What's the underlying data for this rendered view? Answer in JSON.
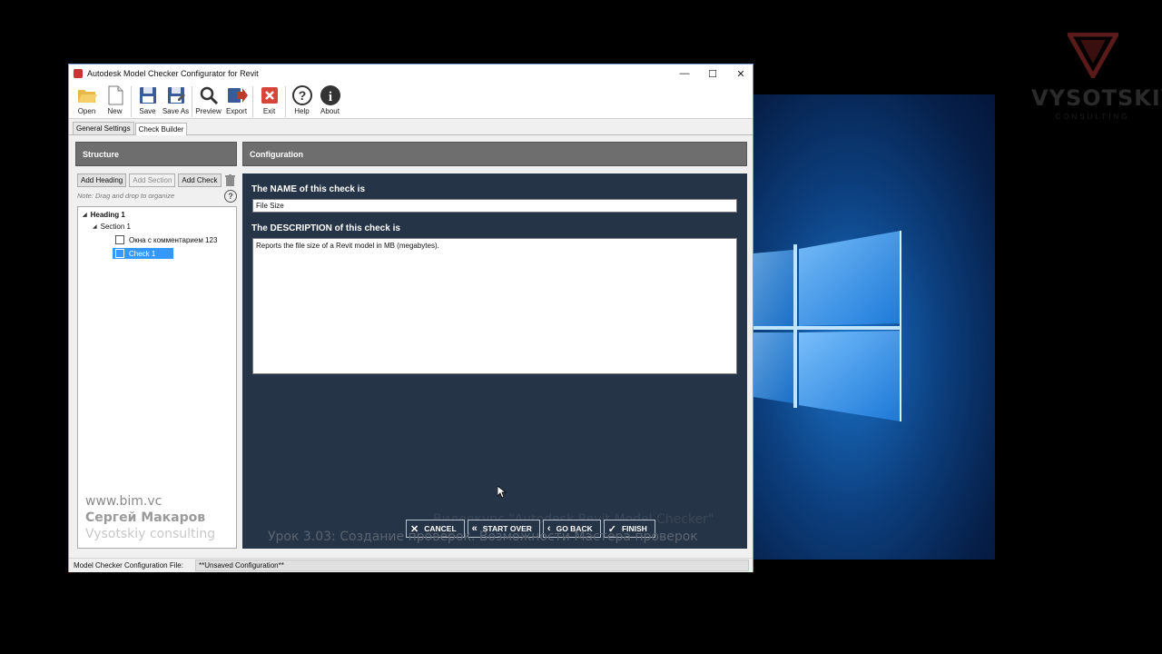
{
  "window": {
    "title": "Autodesk Model Checker Configurator for Revit",
    "controls": {
      "minimize": "—",
      "maximize": "☐",
      "close": "✕"
    }
  },
  "toolbar": {
    "open": "Open",
    "new": "New",
    "save": "Save",
    "save_as": "Save As",
    "preview": "Preview",
    "export": "Export",
    "exit": "Exit",
    "help": "Help",
    "about": "About"
  },
  "tabs": {
    "general": "General Settings",
    "builder": "Check Builder"
  },
  "structure": {
    "header": "Structure",
    "add_heading": "Add Heading",
    "add_section": "Add Section",
    "add_check": "Add Check",
    "note": "Note: Drag and drop to organize",
    "help": "?",
    "tree": {
      "heading": "Heading 1",
      "section": "Section 1",
      "item1": "Окна с комментарием 123",
      "item2": "Check 1"
    }
  },
  "config": {
    "header": "Configuration",
    "name_label": "The NAME of this check is",
    "name_value": "File Size",
    "desc_label": "The DESCRIPTION of this check is",
    "desc_value": "Reports the file size of a Revit model in MB (megabytes)."
  },
  "wizard": {
    "cancel": "CANCEL",
    "start_over": "START OVER",
    "go_back": "GO BACK",
    "finish": "FINISH"
  },
  "status": {
    "label": "Model Checker Configuration File:",
    "value": "**Unsaved Configuration**"
  },
  "overlay": {
    "site": "www.bim.vc",
    "author": "Сергей Макаров",
    "company": "Vysotskiy consulting",
    "line1": "Видеокурс \"Autodesk Revit Model Checker\"",
    "line2": "Урок 3.03: Создание проверок. Возможности Мастера проверок"
  },
  "logo": {
    "name": "VYSOTSKIY",
    "sub": "CONSULTING"
  },
  "colors": {
    "config_bg": "#253447",
    "panel_header": "#6e6e6e",
    "selection": "#3399ff"
  }
}
